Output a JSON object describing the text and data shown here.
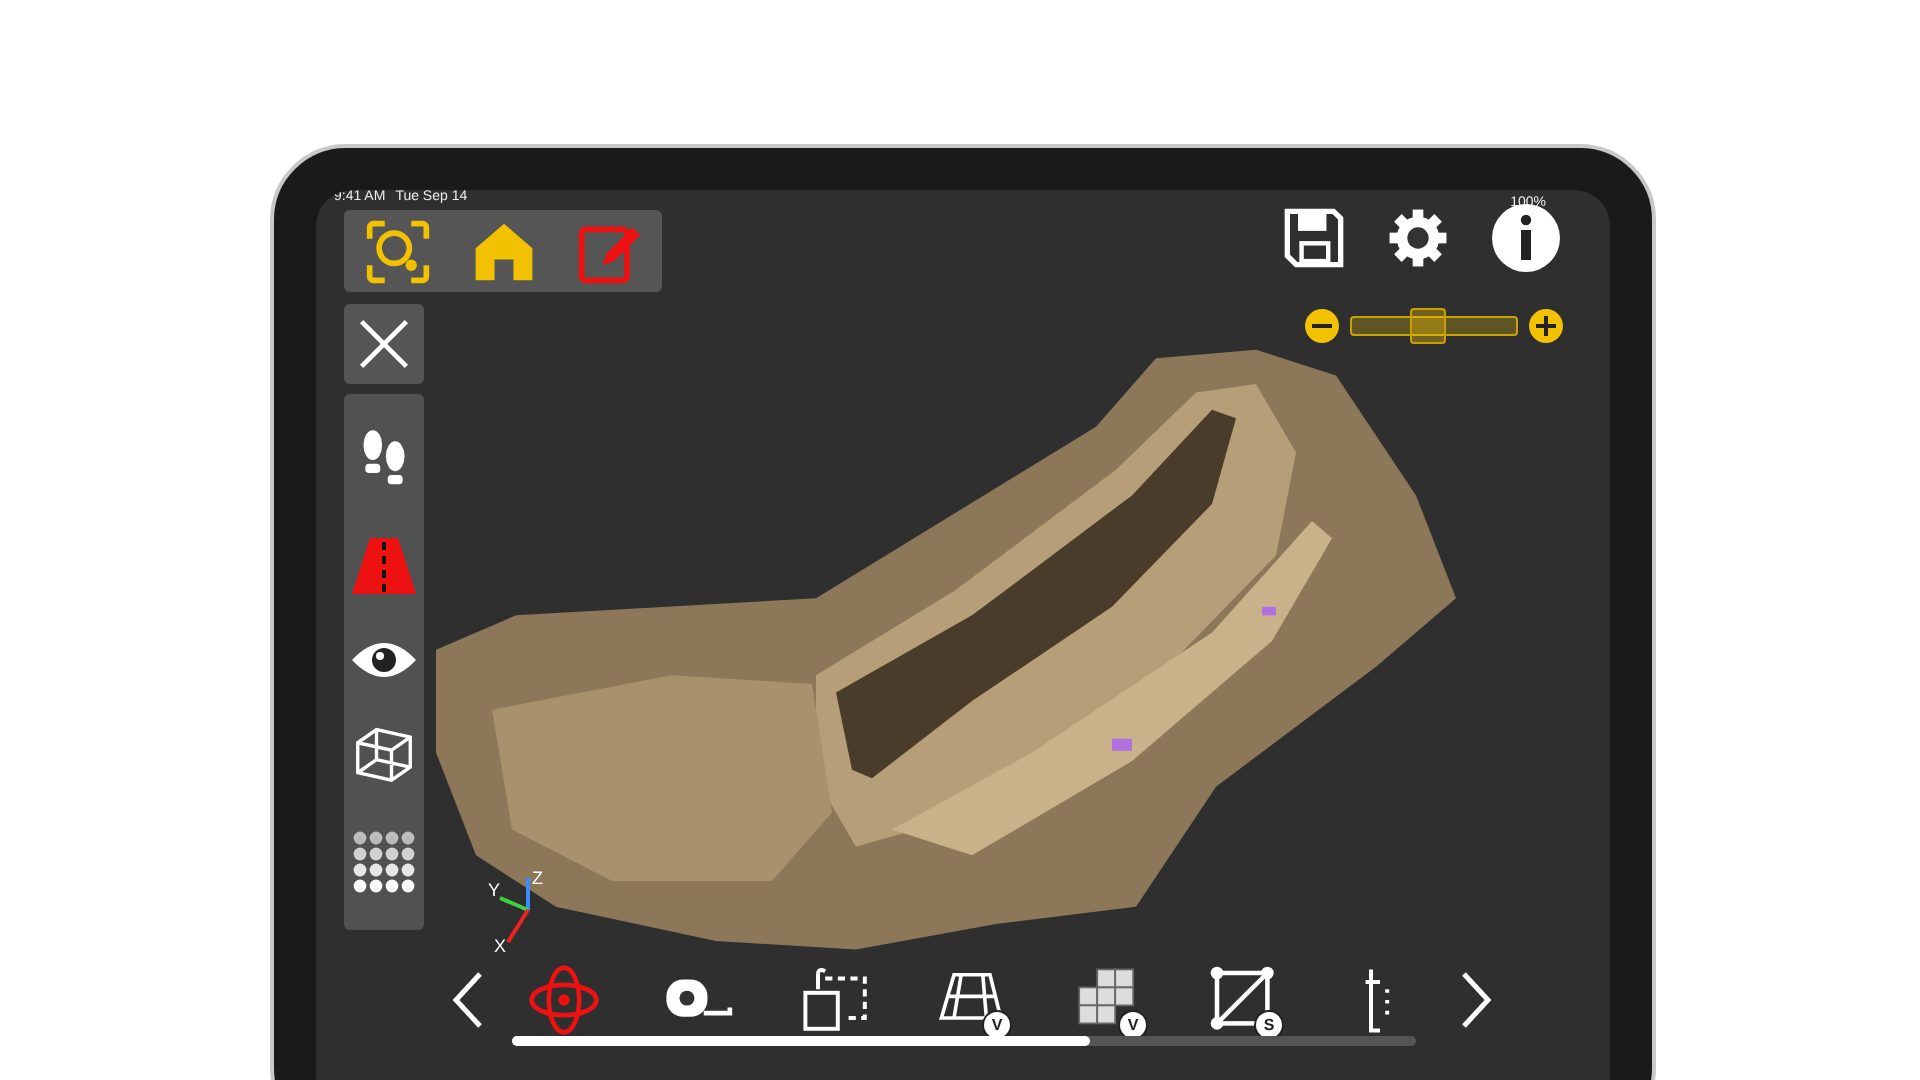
{
  "status_bar": {
    "time": "9:41 AM",
    "date": "Tue Sep 14",
    "battery": "100%"
  },
  "zoom_slider": {
    "level": 0.45
  },
  "left_tools": [
    {
      "kind": "footsteps"
    },
    {
      "kind": "road"
    },
    {
      "kind": "eye"
    },
    {
      "kind": "cube"
    },
    {
      "kind": "dots"
    }
  ],
  "axis": {
    "x": "X",
    "y": "Y",
    "z": "Z"
  },
  "tools": [
    {
      "kind": "rotate",
      "selected": true
    },
    {
      "kind": "tape",
      "selected": false
    },
    {
      "kind": "move",
      "selected": false
    },
    {
      "kind": "surface",
      "selected": false,
      "badge": "V"
    },
    {
      "kind": "blocks",
      "selected": false,
      "badge": "V"
    },
    {
      "kind": "square",
      "selected": false,
      "badge": "S"
    },
    {
      "kind": "ruler",
      "selected": false
    }
  ],
  "scroll": {
    "level": 0.64
  }
}
